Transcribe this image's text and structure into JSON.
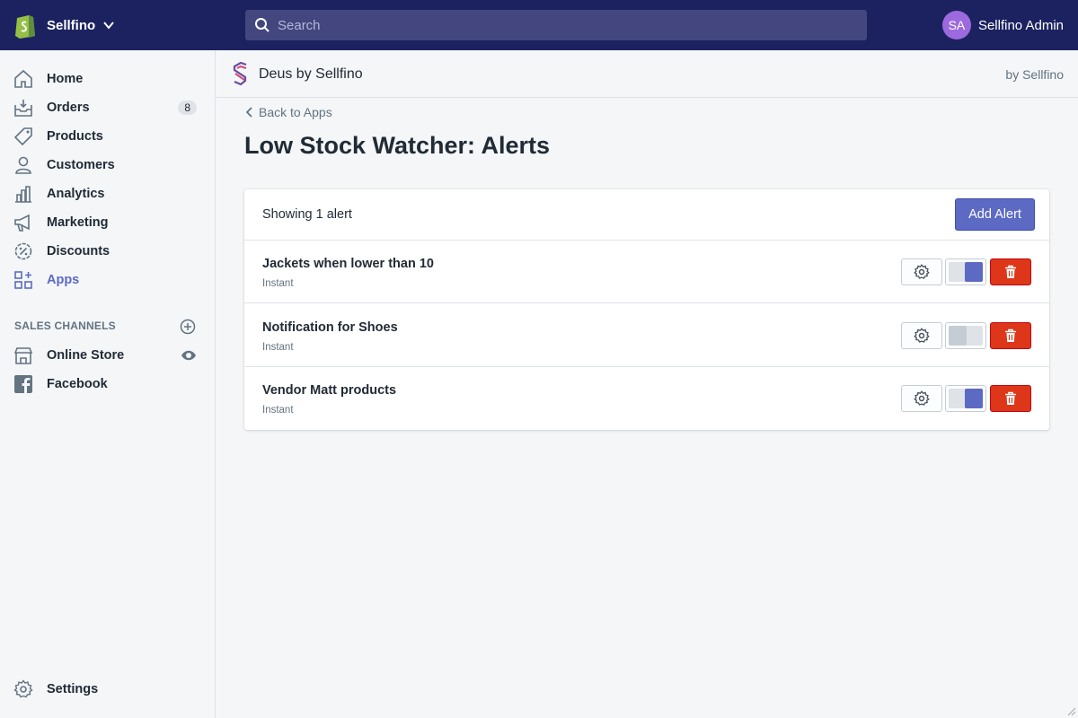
{
  "topbar": {
    "store_name": "Sellfino",
    "search_placeholder": "Search",
    "user_initials": "SA",
    "user_name": "Sellfino Admin",
    "bg_color": "#1c2260",
    "avatar_color": "#9c6ade"
  },
  "sidebar": {
    "items": [
      {
        "label": "Home",
        "icon": "home-icon"
      },
      {
        "label": "Orders",
        "icon": "orders-icon",
        "badge": "8"
      },
      {
        "label": "Products",
        "icon": "tag-icon"
      },
      {
        "label": "Customers",
        "icon": "customer-icon"
      },
      {
        "label": "Analytics",
        "icon": "analytics-icon"
      },
      {
        "label": "Marketing",
        "icon": "megaphone-icon"
      },
      {
        "label": "Discounts",
        "icon": "discount-icon"
      },
      {
        "label": "Apps",
        "icon": "apps-icon",
        "active": true
      }
    ],
    "sales_channels_label": "SALES CHANNELS",
    "channels": [
      {
        "label": "Online Store",
        "icon": "store-icon"
      },
      {
        "label": "Facebook",
        "icon": "facebook-icon"
      }
    ],
    "settings_label": "Settings",
    "active_color": "#5c6ac4"
  },
  "app": {
    "name": "Deus by Sellfino",
    "by": "by Sellfino",
    "back_label": "Back to Apps",
    "page_title": "Low Stock Watcher: Alerts"
  },
  "alerts": {
    "showing": "Showing 1 alert",
    "add_label": "Add Alert",
    "rows": [
      {
        "name": "Jackets when lower than 10",
        "type": "Instant",
        "enabled": true
      },
      {
        "name": "Notification for Shoes",
        "type": "Instant",
        "enabled": false
      },
      {
        "name": "Vendor Matt products",
        "type": "Instant",
        "enabled": true
      }
    ],
    "primary_color": "#5c6ac4",
    "danger_color": "#de3618"
  }
}
